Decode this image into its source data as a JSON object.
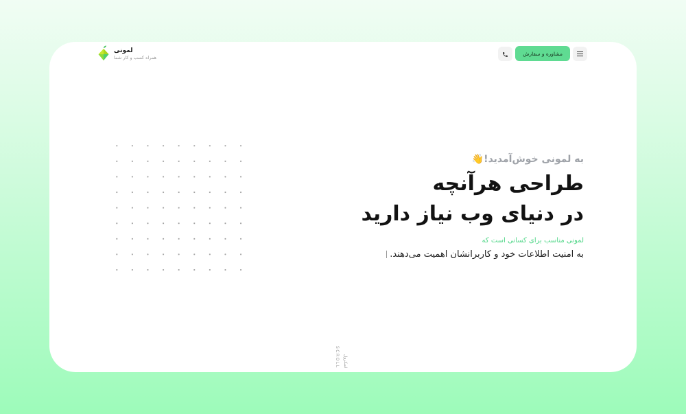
{
  "brand": {
    "name": "لمونی",
    "tagline": "همراه کسب و کار شما",
    "logo_icon": "lemon-logo-icon"
  },
  "header": {
    "order_button": "مشاوره و سفارش",
    "phone_icon": "phone-icon",
    "menu_icon": "hamburger-menu-icon"
  },
  "hero": {
    "welcome": "به لمونی خوش‌آمدید!👋",
    "headline_line1": "طراحی هرآنچه",
    "headline_line2": "در دنیای وب نیاز دارید",
    "sub_green": "لمونی مناسب برای کسانی است که",
    "sub_dark": "به امنیت اطلاعات خود و کاربرانشان اهمیت می‌دهند."
  },
  "scroll": {
    "label_en": "SCROLL",
    "label_fa": "اسکرول"
  },
  "colors": {
    "accent": "#5fdb92",
    "accent_text": "#4fd687",
    "background_top": "#f1fdf4",
    "background_bottom": "#9dfbba"
  }
}
